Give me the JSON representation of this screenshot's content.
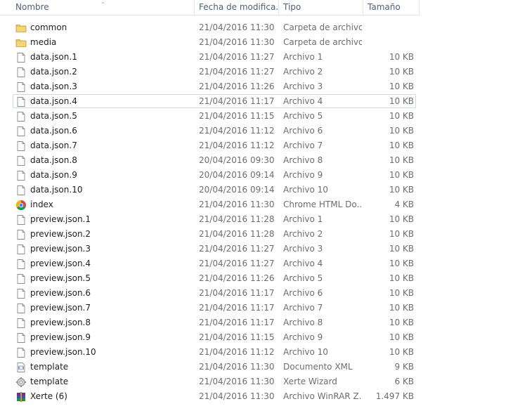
{
  "columns": {
    "name": "Nombre",
    "date": "Fecha de modifica...",
    "type": "Tipo",
    "size": "Tamaño"
  },
  "files": [
    {
      "icon": "folder-icon",
      "name": "common",
      "date": "21/04/2016 11:30 a...",
      "type": "Carpeta de archivos",
      "size": ""
    },
    {
      "icon": "folder-icon",
      "name": "media",
      "date": "21/04/2016 11:30 a...",
      "type": "Carpeta de archivos",
      "size": ""
    },
    {
      "icon": "file-icon",
      "name": "data.json.1",
      "date": "21/04/2016 11:27 a...",
      "type": "Archivo 1",
      "size": "10 KB"
    },
    {
      "icon": "file-icon",
      "name": "data.json.2",
      "date": "21/04/2016 11:27 a...",
      "type": "Archivo 2",
      "size": "10 KB"
    },
    {
      "icon": "file-icon",
      "name": "data.json.3",
      "date": "21/04/2016 11:26 a...",
      "type": "Archivo 3",
      "size": "10 KB"
    },
    {
      "icon": "file-icon",
      "name": "data.json.4",
      "date": "21/04/2016 11:17 a...",
      "type": "Archivo 4",
      "size": "10 KB",
      "focused": true
    },
    {
      "icon": "file-icon",
      "name": "data.json.5",
      "date": "21/04/2016 11:15 a...",
      "type": "Archivo 5",
      "size": "10 KB"
    },
    {
      "icon": "file-icon",
      "name": "data.json.6",
      "date": "21/04/2016 11:12 a...",
      "type": "Archivo 6",
      "size": "10 KB"
    },
    {
      "icon": "file-icon",
      "name": "data.json.7",
      "date": "21/04/2016 11:12 a...",
      "type": "Archivo 7",
      "size": "10 KB"
    },
    {
      "icon": "file-icon",
      "name": "data.json.8",
      "date": "20/04/2016 09:30 a...",
      "type": "Archivo 8",
      "size": "10 KB"
    },
    {
      "icon": "file-icon",
      "name": "data.json.9",
      "date": "20/04/2016 09:14 a...",
      "type": "Archivo 9",
      "size": "10 KB"
    },
    {
      "icon": "file-icon",
      "name": "data.json.10",
      "date": "20/04/2016 09:14 a...",
      "type": "Archivo 10",
      "size": "10 KB"
    },
    {
      "icon": "chrome-icon",
      "name": "index",
      "date": "21/04/2016 11:30 a...",
      "type": "Chrome HTML Do...",
      "size": "4 KB"
    },
    {
      "icon": "file-icon",
      "name": "preview.json.1",
      "date": "21/04/2016 11:28 a...",
      "type": "Archivo 1",
      "size": "10 KB"
    },
    {
      "icon": "file-icon",
      "name": "preview.json.2",
      "date": "21/04/2016 11:28 a...",
      "type": "Archivo 2",
      "size": "10 KB"
    },
    {
      "icon": "file-icon",
      "name": "preview.json.3",
      "date": "21/04/2016 11:27 a...",
      "type": "Archivo 3",
      "size": "10 KB"
    },
    {
      "icon": "file-icon",
      "name": "preview.json.4",
      "date": "21/04/2016 11:27 a...",
      "type": "Archivo 4",
      "size": "10 KB"
    },
    {
      "icon": "file-icon",
      "name": "preview.json.5",
      "date": "21/04/2016 11:26 a...",
      "type": "Archivo 5",
      "size": "10 KB"
    },
    {
      "icon": "file-icon",
      "name": "preview.json.6",
      "date": "21/04/2016 11:17 a...",
      "type": "Archivo 6",
      "size": "10 KB"
    },
    {
      "icon": "file-icon",
      "name": "preview.json.7",
      "date": "21/04/2016 11:17 a...",
      "type": "Archivo 7",
      "size": "10 KB"
    },
    {
      "icon": "file-icon",
      "name": "preview.json.8",
      "date": "21/04/2016 11:17 a...",
      "type": "Archivo 8",
      "size": "10 KB"
    },
    {
      "icon": "file-icon",
      "name": "preview.json.9",
      "date": "21/04/2016 11:15 a...",
      "type": "Archivo 9",
      "size": "10 KB"
    },
    {
      "icon": "file-icon",
      "name": "preview.json.10",
      "date": "21/04/2016 11:12 a...",
      "type": "Archivo 10",
      "size": "10 KB"
    },
    {
      "icon": "xml-file-icon",
      "name": "template",
      "date": "21/04/2016 11:30 a...",
      "type": "Documento XML",
      "size": "9 KB"
    },
    {
      "icon": "gear-file-icon",
      "name": "template",
      "date": "21/04/2016 11:30 a...",
      "type": "Xerte Wizard",
      "size": "6 KB"
    },
    {
      "icon": "winrar-icon",
      "name": "Xerte (6)",
      "date": "21/04/2016 11:30 a...",
      "type": "Archivo WinRAR Z...",
      "size": "1.497 KB"
    }
  ],
  "colors": {
    "header_text": "#4c607a",
    "name_text": "#1e1e1e",
    "detail_text": "#6d6d6d",
    "focus_border": "#c5d8ec",
    "folder": "#e8c25a"
  }
}
